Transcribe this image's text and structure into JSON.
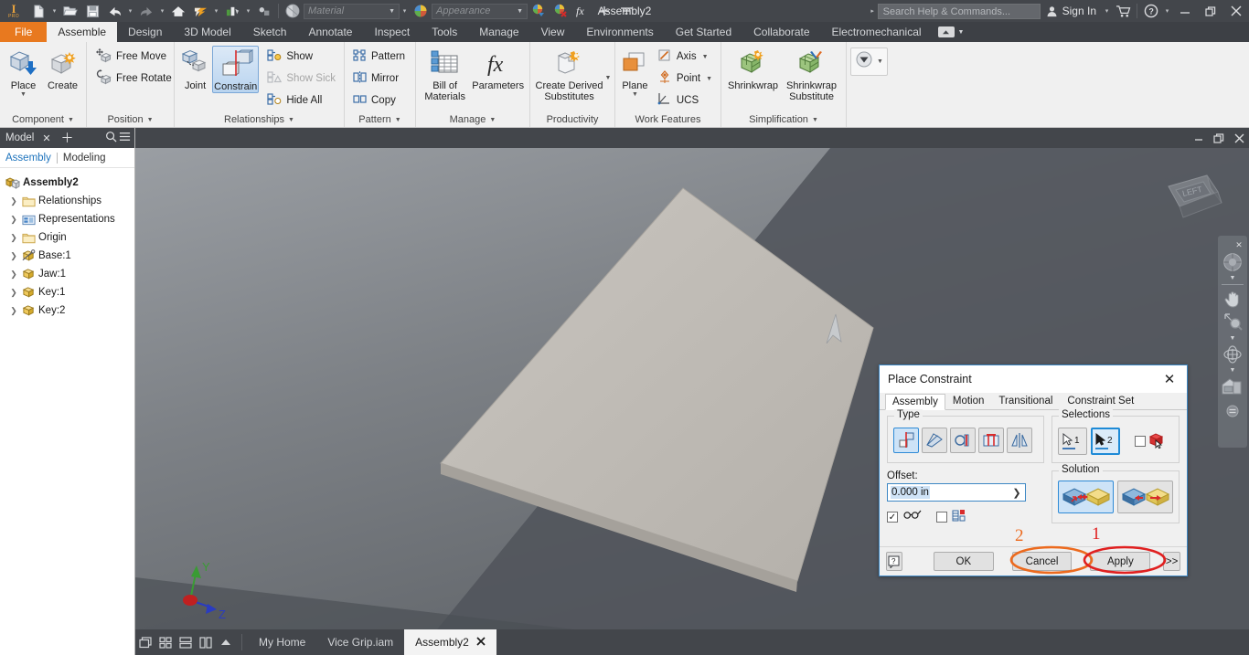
{
  "titlebar": {
    "product_short": "I",
    "product_sub": "PRO",
    "document_title": "Assembly2",
    "appearance_placeholder": "Appearance",
    "material_placeholder": "Material",
    "search_placeholder": "Search Help & Commands...",
    "signin_label": "Sign In",
    "qat_icons": [
      "new-icon",
      "open-icon",
      "save-icon",
      "undo-icon",
      "redo-icon",
      "home-icon",
      "update-icon",
      "materials-icon",
      "select-icon",
      "appearance-browser-icon"
    ],
    "window_buttons": [
      "minimize-icon",
      "restore-icon",
      "close-icon"
    ]
  },
  "ribbon_tabs": {
    "file": "File",
    "items": [
      {
        "label": "Assemble",
        "active": true
      },
      {
        "label": "Design",
        "active": false
      },
      {
        "label": "3D Model",
        "active": false
      },
      {
        "label": "Sketch",
        "active": false
      },
      {
        "label": "Annotate",
        "active": false
      },
      {
        "label": "Inspect",
        "active": false
      },
      {
        "label": "Tools",
        "active": false
      },
      {
        "label": "Manage",
        "active": false
      },
      {
        "label": "View",
        "active": false
      },
      {
        "label": "Environments",
        "active": false
      },
      {
        "label": "Get Started",
        "active": false
      },
      {
        "label": "Collaborate",
        "active": false
      },
      {
        "label": "Electromechanical",
        "active": false
      }
    ]
  },
  "ribbon": {
    "panels": [
      {
        "title": "Component",
        "has_caret": true,
        "big_buttons": [
          {
            "label": "Place",
            "icon": "place-component-icon",
            "dropdown": true
          },
          {
            "label": "Create",
            "icon": "create-component-icon",
            "dropdown": false
          }
        ]
      },
      {
        "title": "Position",
        "has_caret": true,
        "small_buttons": [
          {
            "label": "Free Move",
            "icon": "free-move-icon",
            "disabled": false
          },
          {
            "label": "Free Rotate",
            "icon": "free-rotate-icon",
            "disabled": false
          }
        ]
      },
      {
        "title": "Relationships",
        "has_caret": true,
        "big_buttons": [
          {
            "label": "Joint",
            "icon": "joint-icon",
            "dropdown": false
          },
          {
            "label": "Constrain",
            "icon": "constrain-icon",
            "dropdown": false,
            "selected": true
          }
        ],
        "small_buttons": [
          {
            "label": "Show",
            "icon": "show-relationship-icon",
            "disabled": false
          },
          {
            "label": "Show Sick",
            "icon": "show-sick-icon",
            "disabled": true
          },
          {
            "label": "Hide All",
            "icon": "hide-all-icon",
            "disabled": false
          }
        ]
      },
      {
        "title": "Pattern",
        "has_caret": true,
        "small_buttons": [
          {
            "label": "Pattern",
            "icon": "pattern-icon",
            "disabled": false
          },
          {
            "label": "Mirror",
            "icon": "mirror-icon",
            "disabled": false
          },
          {
            "label": "Copy",
            "icon": "copy-icon",
            "disabled": false
          }
        ]
      },
      {
        "title": "Manage",
        "has_caret": true,
        "big_buttons": [
          {
            "label": "Bill of Materials",
            "icon": "bill-of-materials-icon",
            "dropdown": false
          },
          {
            "label": "Parameters",
            "icon": "parameters-icon",
            "dropdown": false
          }
        ]
      },
      {
        "title": "Productivity",
        "has_caret": false,
        "big_buttons": [
          {
            "label": "Create Derived Substitutes",
            "icon": "create-derived-substitutes-icon",
            "dropdown": true
          }
        ]
      },
      {
        "title": "Work Features",
        "has_caret": false,
        "big_buttons": [
          {
            "label": "Plane",
            "icon": "work-plane-icon",
            "dropdown": true
          }
        ],
        "small_buttons": [
          {
            "label": "Axis",
            "icon": "work-axis-icon",
            "disabled": false,
            "caret": true
          },
          {
            "label": "Point",
            "icon": "work-point-icon",
            "disabled": false,
            "caret": true
          },
          {
            "label": "UCS",
            "icon": "ucs-icon",
            "disabled": false
          }
        ]
      },
      {
        "title": "Simplification",
        "has_caret": true,
        "big_buttons": [
          {
            "label": "Shrinkwrap",
            "icon": "shrinkwrap-icon",
            "dropdown": false
          },
          {
            "label": "Shrinkwrap Substitute",
            "icon": "shrinkwrap-substitute-icon",
            "dropdown": false
          }
        ]
      },
      {
        "title": "",
        "has_caret": false,
        "big_buttons": [
          {
            "label": "",
            "icon": "convert-icon",
            "dropdown": true
          }
        ]
      }
    ]
  },
  "browser": {
    "tab_label": "Model",
    "close_icon": "close-icon",
    "add_icon": "add-tab-icon",
    "search_icon": "search-icon",
    "menu_icon": "hamburger-menu-icon",
    "sub_tabs": [
      {
        "label": "Assembly",
        "active": true
      },
      {
        "label": "Modeling",
        "active": false
      }
    ],
    "tree": {
      "root": {
        "label": "Assembly2",
        "icon": "assembly-icon"
      },
      "nodes": [
        {
          "label": "Relationships",
          "icon": "folder-icon"
        },
        {
          "label": "Representations",
          "icon": "representations-icon"
        },
        {
          "label": "Origin",
          "icon": "folder-icon"
        },
        {
          "label": "Base:1",
          "icon": "grounded-part-icon"
        },
        {
          "label": "Jaw:1",
          "icon": "part-icon"
        },
        {
          "label": "Key:1",
          "icon": "part-icon"
        },
        {
          "label": "Key:2",
          "icon": "part-icon"
        }
      ]
    }
  },
  "viewport": {
    "viewcube_face": "LEFT",
    "axis_labels": {
      "y": "Y",
      "z": "Z"
    },
    "navbar_items": [
      "full-navigation-wheel-icon",
      "pan-icon",
      "zoom-icon",
      "orbit-icon",
      "look-at-icon",
      "nav-settings-icon"
    ],
    "navbar_close": "close-icon"
  },
  "document_window": {
    "buttons": [
      "minimize-icon",
      "restore-icon",
      "close-icon"
    ]
  },
  "statusbar": {
    "layout_icons": [
      "cascade-icon",
      "tile-grid-icon",
      "tile-horizontal-icon",
      "tile-vertical-icon",
      "expand-up-icon"
    ],
    "tabs": [
      {
        "label": "My Home",
        "active": false,
        "closable": false
      },
      {
        "label": "Vice Grip.iam",
        "active": false,
        "closable": false
      },
      {
        "label": "Assembly2",
        "active": true,
        "closable": true
      }
    ]
  },
  "dialog": {
    "title": "Place Constraint",
    "close_icon": "close-icon",
    "tabs": [
      {
        "label": "Assembly",
        "active": true
      },
      {
        "label": "Motion",
        "active": false
      },
      {
        "label": "Transitional",
        "active": false
      },
      {
        "label": "Constraint Set",
        "active": false
      }
    ],
    "type_group": {
      "label": "Type",
      "buttons": [
        {
          "name": "mate-constraint-icon",
          "selected": true
        },
        {
          "name": "angle-constraint-icon",
          "selected": false
        },
        {
          "name": "tangent-constraint-icon",
          "selected": false
        },
        {
          "name": "insert-constraint-icon",
          "selected": false
        },
        {
          "name": "symmetry-constraint-icon",
          "selected": false
        }
      ]
    },
    "selections_group": {
      "label": "Selections",
      "buttons": [
        {
          "label": "1",
          "name": "selection-1-button",
          "selected": false
        },
        {
          "label": "2",
          "name": "selection-2-button",
          "selected": true
        }
      ],
      "pick_part_first_checked": false,
      "pick_part_first_icon": "pick-part-first-icon"
    },
    "offset": {
      "label": "Offset:",
      "value": "0.000 in",
      "expand_icon": "expand-arrow-icon"
    },
    "options": {
      "show_preview_checked": true,
      "show_preview_icon": "show-preview-glasses-icon",
      "predict_offset_checked": false,
      "predict_offset_icon": "predict-offset-icon"
    },
    "solution_group": {
      "label": "Solution",
      "buttons": [
        {
          "name": "solution-opposed-icon",
          "selected": true
        },
        {
          "name": "solution-aligned-icon",
          "selected": false
        }
      ]
    },
    "footer": {
      "help_label": "?",
      "ok_label": "OK",
      "cancel_label": "Cancel",
      "apply_label": "Apply",
      "more_label": ">>"
    }
  },
  "annotations": [
    {
      "number": "1",
      "target": "apply-button",
      "color": "#e02020"
    },
    {
      "number": "2",
      "target": "cancel-button",
      "color": "#ec6a1e"
    }
  ],
  "colors": {
    "accent_orange": "#e8791f",
    "ribbon_bg": "#f0f0f0",
    "chrome_dark": "#43464b",
    "dialog_border": "#3d87c4",
    "annotation_red": "#e02020",
    "annotation_orange": "#ec6a1e",
    "link_blue": "#1f74bd"
  }
}
